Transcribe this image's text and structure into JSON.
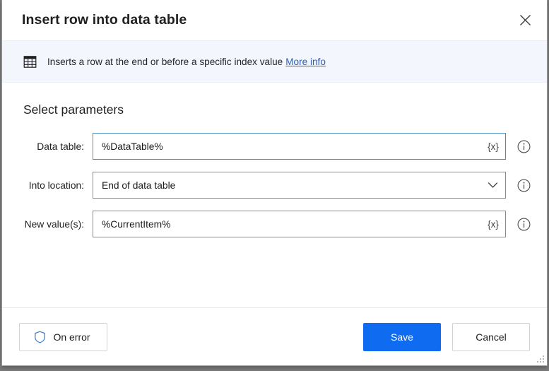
{
  "dialog": {
    "title": "Insert row into data table",
    "close_icon": "close-icon"
  },
  "banner": {
    "icon": "table-grid-icon",
    "text": "Inserts a row at the end or before a specific index value",
    "link_label": "More info"
  },
  "main": {
    "section_title": "Select parameters",
    "fields": [
      {
        "label": "Data table:",
        "value": "%DataTable%",
        "control": "text",
        "trailing_icon": "variable-braces-icon",
        "trailing_label": "{x}",
        "info_icon": "info-circle-icon",
        "focused": true
      },
      {
        "label": "Into location:",
        "value": "End of data table",
        "control": "dropdown",
        "trailing_icon": "chevron-down-icon",
        "trailing_label": "",
        "info_icon": "info-circle-icon",
        "focused": false
      },
      {
        "label": "New value(s):",
        "value": "%CurrentItem%",
        "control": "text",
        "trailing_icon": "variable-braces-icon",
        "trailing_label": "{x}",
        "info_icon": "info-circle-icon",
        "focused": false
      }
    ]
  },
  "footer": {
    "on_error_label": "On error",
    "on_error_icon": "shield-icon",
    "save_label": "Save",
    "cancel_label": "Cancel",
    "resize_grip": "resize-grip-icon"
  },
  "colors": {
    "accent_blue": "#0f6cf0",
    "link_blue": "#2b5fb8",
    "banner_bg": "#f3f6fc",
    "focus_border": "#4a8ec4",
    "field_border": "#8b8b8b",
    "shield_blue": "#3d7ec4"
  }
}
